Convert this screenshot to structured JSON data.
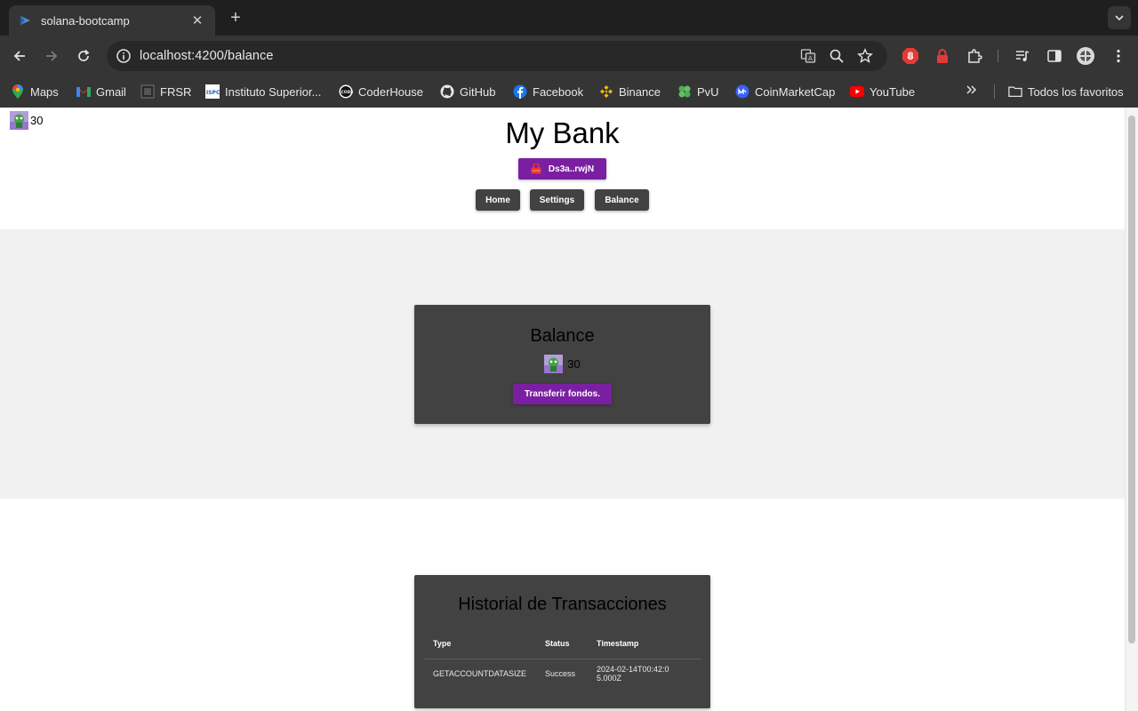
{
  "browser": {
    "tab_title": "solana-bootcamp",
    "url_host": "localhost",
    "url_path": ":4200/balance",
    "bookmarks": [
      "Maps",
      "Gmail",
      "FRSR",
      "Instituto Superior...",
      "CoderHouse",
      "GitHub",
      "Facebook",
      "Binance",
      "PvU",
      "CoinMarketCap",
      "YouTube"
    ],
    "all_bookmarks": "Todos los favoritos"
  },
  "app": {
    "mini_balance": "30",
    "title": "My Bank",
    "wallet_label": "Ds3a..rwjN",
    "nav": [
      "Home",
      "Settings",
      "Balance"
    ],
    "accent_color": "#7b1fa2"
  },
  "balance_card": {
    "title": "Balance",
    "amount": "30",
    "transfer_label": "Transferir fondos."
  },
  "history": {
    "title": "Historial de Transacciones",
    "columns": [
      "Type",
      "Status",
      "Timestamp"
    ],
    "rows": [
      {
        "type": "GETACCOUNTDATASIZE",
        "status": "Success",
        "timestamp": "2024-02-14T00:42:05.000Z"
      }
    ]
  }
}
